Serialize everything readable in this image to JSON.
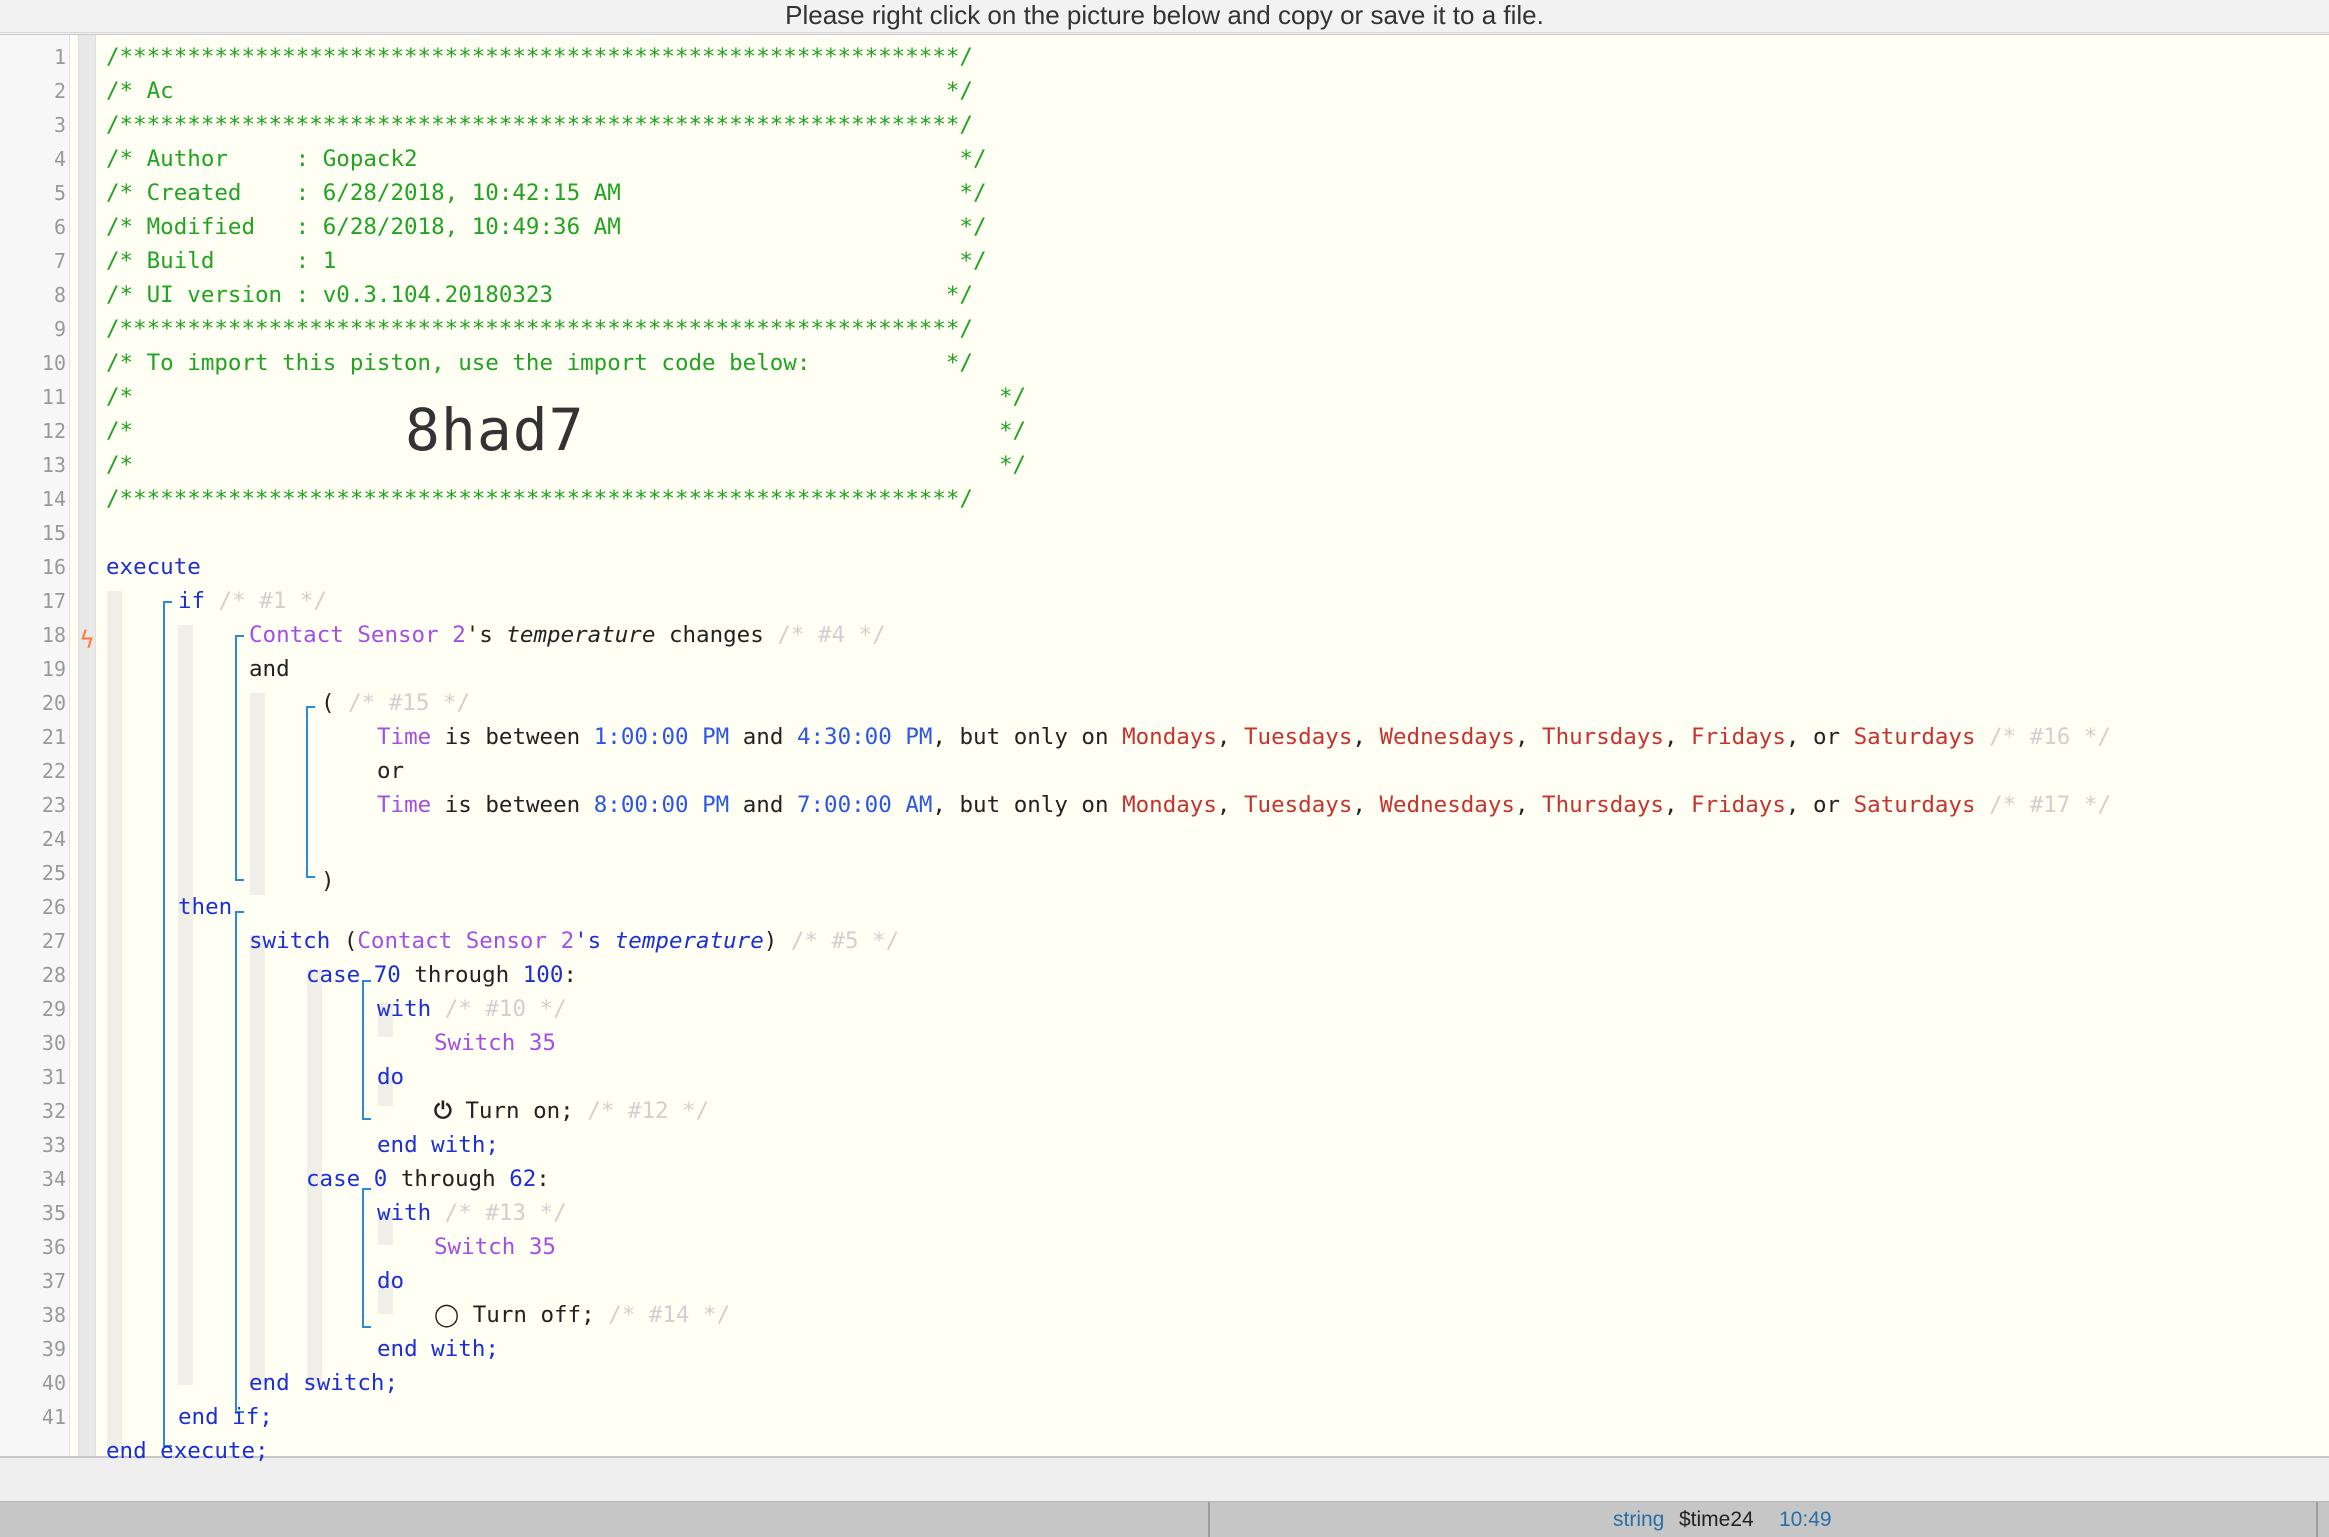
{
  "top_bar": {
    "message": "Please right click on the picture below and copy or save it to a file."
  },
  "import_code": "8had7",
  "line_numbers": [
    "1",
    "2",
    "3",
    "4",
    "5",
    "6",
    "7",
    "8",
    "9",
    "10",
    "11",
    "12",
    "13",
    "14",
    "15",
    "16",
    "17",
    "18",
    "19",
    "20",
    "21",
    "22",
    "23",
    "24",
    "25",
    "26",
    "27",
    "28",
    "29",
    "30",
    "31",
    "32",
    "33",
    "34",
    "35",
    "36",
    "37",
    "38",
    "39",
    "40",
    "41"
  ],
  "header": {
    "stars": "/**************************************************************/",
    "title": "/* Ac                                                         */",
    "author": "/* Author     : Gopack2                                        */",
    "created": "/* Created    : 6/28/2018, 10:42:15 AM                         */",
    "modified": "/* Modified   : 6/28/2018, 10:49:36 AM                         */",
    "build": "/* Build      : 1                                              */",
    "ui_version": "/* UI version : v0.3.104.20180323                             */",
    "import_hint": "/* To import this piston, use the import code below:          */",
    "blank_open": "/*",
    "blank_close": "*/"
  },
  "code": {
    "execute": "execute",
    "if": "if",
    "c1": "/* #1 */",
    "device": "Contact Sensor 2",
    "poss": "'s ",
    "temperature": "temperature",
    "changes": " changes",
    "c4": "/* #4 */",
    "and_kw": "and",
    "paren_open": "(",
    "c15": "/* #15 */",
    "time": "Time",
    "is_between": " is between ",
    "t1": "1:00:00 PM",
    "and_word": " and ",
    "t2": "4:30:00 PM",
    "but_only": ", but only on ",
    "mondays": "Mondays",
    "tuesdays": "Tuesdays",
    "wednesdays": "Wednesdays",
    "thursdays": "Thursdays",
    "fridays": "Fridays",
    "saturdays": "Saturdays",
    "comma": ", ",
    "or_mid": ", or ",
    "c16": "/* #16 */",
    "or_kw": "or",
    "t3": "8:00:00 PM",
    "t4": "7:00:00 AM",
    "c17": "/* #17 */",
    "paren_close": ")",
    "then": "then",
    "switch": "switch",
    "switch_open": " (",
    "switch_close": ")",
    "c5": "/* #5 */",
    "case": "case",
    "n70": "70",
    "through": " through ",
    "n100": "100",
    "colon": ":",
    "with": "with",
    "c10": "/* #10 */",
    "switch35": "Switch 35",
    "do": "do",
    "power_on_glyph": "⏻",
    "turn_on": " Turn on;",
    "c12": "/* #12 */",
    "end_with": "end with;",
    "n0": "0",
    "n62": "62",
    "c13": "/* #13 */",
    "power_off_glyph": "◯",
    "turn_off": " Turn off;",
    "c14": "/* #14 */",
    "end_switch": "end switch;",
    "end_if": "end if;",
    "end_execute": "end execute;"
  },
  "status_bar": {
    "type": "string",
    "variable": "$time24",
    "value": "10:49"
  },
  "colors": {
    "comment_green": "#22a322",
    "keyword_blue": "#1c2fd6",
    "device_purple": "#a54ee6",
    "day_red": "#c8322e",
    "time_blue": "#2b56e6",
    "bracket_blue": "#2a8ad6",
    "trigger_orange": "#ff7a33"
  }
}
